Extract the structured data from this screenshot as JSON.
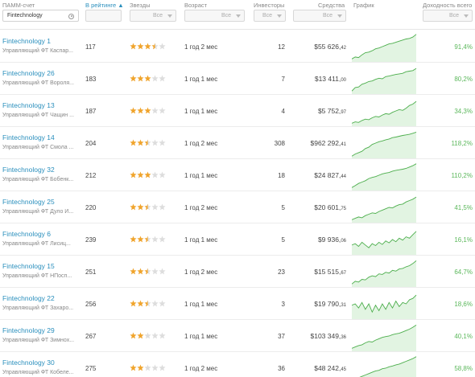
{
  "header": {
    "account_label": "ПАММ-счет",
    "account_filter": "Fintechnology",
    "rating_label": "В рейтинге ▲",
    "rating_filter": "",
    "stars_label": "Звезды",
    "stars_filter": "Все",
    "age_label": "Возраст",
    "age_filter": "Все",
    "investors_label": "Инвесторы",
    "investors_filter": "Все",
    "funds_label": "Средства",
    "funds_filter": "Все",
    "chart_label": "График",
    "yield_label": "Доходность всего",
    "yield_filter": "Все"
  },
  "colors": {
    "link": "#2a8fbd",
    "positive": "#5cb85c",
    "star": "#f0a42c",
    "star_empty": "#dddddd",
    "spark_line": "#4cae4c",
    "spark_fill": "#e2f4e2"
  },
  "rows": [
    {
      "name": "Fintechnology 1",
      "manager": "Управляющий ФТ Каспар...",
      "rank": "117",
      "stars": 3.5,
      "age": "1 год 2 мес",
      "investors": "12",
      "funds": "$55 626,",
      "funds_cents": "42",
      "yield": "91,4%",
      "spark": [
        0.05,
        0.12,
        0.1,
        0.2,
        0.28,
        0.3,
        0.35,
        0.42,
        0.45,
        0.5,
        0.55,
        0.6,
        0.62,
        0.66,
        0.7,
        0.74,
        0.78,
        0.8,
        0.85,
        0.95
      ]
    },
    {
      "name": "Fintechnology 26",
      "manager": "Управляющий ФТ Вороля...",
      "rank": "183",
      "stars": 3,
      "age": "1 год 1 мес",
      "investors": "7",
      "funds": "$13 411,",
      "funds_cents": "00",
      "yield": "80,2%",
      "spark": [
        0.05,
        0.18,
        0.2,
        0.3,
        0.34,
        0.4,
        0.42,
        0.48,
        0.52,
        0.5,
        0.58,
        0.6,
        0.63,
        0.66,
        0.68,
        0.7,
        0.76,
        0.78,
        0.8,
        0.88
      ]
    },
    {
      "name": "Fintechnology 13",
      "manager": "Управляющий ФТ Чащин ...",
      "rank": "187",
      "stars": 3,
      "age": "1 год 1 мес",
      "investors": "4",
      "funds": "$5 752,",
      "funds_cents": "97",
      "yield": "34,3%",
      "spark": [
        0.05,
        0.1,
        0.08,
        0.15,
        0.2,
        0.18,
        0.25,
        0.3,
        0.28,
        0.35,
        0.4,
        0.38,
        0.45,
        0.5,
        0.55,
        0.52,
        0.6,
        0.7,
        0.75,
        0.85
      ]
    },
    {
      "name": "Fintechnology 14",
      "manager": "Управляющий ФТ Смола ...",
      "rank": "204",
      "stars": 2.5,
      "age": "1 год 2 мес",
      "investors": "308",
      "funds": "$962 292,",
      "funds_cents": "41",
      "yield": "118,2%",
      "spark": [
        0.02,
        0.1,
        0.15,
        0.2,
        0.3,
        0.35,
        0.45,
        0.5,
        0.55,
        0.58,
        0.62,
        0.65,
        0.7,
        0.72,
        0.75,
        0.78,
        0.8,
        0.82,
        0.86,
        0.9
      ]
    },
    {
      "name": "Fintechnology 32",
      "manager": "Управляющий ФТ Бобенк...",
      "rank": "212",
      "stars": 3,
      "age": "1 год 1 мес",
      "investors": "18",
      "funds": "$24 827,",
      "funds_cents": "44",
      "yield": "110,2%",
      "spark": [
        0.05,
        0.12,
        0.2,
        0.25,
        0.3,
        0.38,
        0.42,
        0.45,
        0.5,
        0.55,
        0.58,
        0.6,
        0.65,
        0.68,
        0.7,
        0.72,
        0.75,
        0.8,
        0.85,
        0.92
      ]
    },
    {
      "name": "Fintechnology 25",
      "manager": "Управляющий ФТ Дуло И...",
      "rank": "220",
      "stars": 2.5,
      "age": "1 год 2 мес",
      "investors": "5",
      "funds": "$20 601,",
      "funds_cents": "75",
      "yield": "41,5%",
      "spark": [
        0.05,
        0.1,
        0.15,
        0.12,
        0.2,
        0.25,
        0.3,
        0.28,
        0.35,
        0.4,
        0.45,
        0.5,
        0.48,
        0.55,
        0.6,
        0.62,
        0.7,
        0.75,
        0.8,
        0.88
      ]
    },
    {
      "name": "Fintechnology 6",
      "manager": "Управляющий ФТ Лисиц...",
      "rank": "239",
      "stars": 2.5,
      "age": "1 год 1 мес",
      "investors": "5",
      "funds": "$9 936,",
      "funds_cents": "06",
      "yield": "16,1%",
      "spark": [
        0.3,
        0.35,
        0.25,
        0.4,
        0.3,
        0.2,
        0.35,
        0.28,
        0.4,
        0.32,
        0.45,
        0.38,
        0.5,
        0.42,
        0.55,
        0.48,
        0.6,
        0.55,
        0.68,
        0.8
      ]
    },
    {
      "name": "Fintechnology 15",
      "manager": "Управляющий ФТ НПосп...",
      "rank": "251",
      "stars": 2.5,
      "age": "1 год 2 мес",
      "investors": "23",
      "funds": "$15 515,",
      "funds_cents": "67",
      "yield": "64,7%",
      "spark": [
        0.05,
        0.15,
        0.12,
        0.22,
        0.2,
        0.3,
        0.35,
        0.32,
        0.42,
        0.4,
        0.48,
        0.45,
        0.55,
        0.52,
        0.6,
        0.62,
        0.68,
        0.72,
        0.8,
        0.9
      ]
    },
    {
      "name": "Fintechnology 22",
      "manager": "Управляющий ФТ Захаро...",
      "rank": "256",
      "stars": 2.5,
      "age": "1 год 1 мес",
      "investors": "3",
      "funds": "$19 790,",
      "funds_cents": "31",
      "yield": "18,6%",
      "spark": [
        0.45,
        0.5,
        0.35,
        0.55,
        0.3,
        0.5,
        0.2,
        0.45,
        0.25,
        0.5,
        0.3,
        0.55,
        0.35,
        0.6,
        0.4,
        0.55,
        0.5,
        0.65,
        0.7,
        0.82
      ]
    },
    {
      "name": "Fintechnology 29",
      "manager": "Управляющий ФТ Зимнох...",
      "rank": "267",
      "stars": 2,
      "age": "1 год 1 мес",
      "investors": "37",
      "funds": "$103 349,",
      "funds_cents": "36",
      "yield": "40,1%",
      "spark": [
        0.05,
        0.1,
        0.15,
        0.18,
        0.25,
        0.3,
        0.28,
        0.35,
        0.4,
        0.45,
        0.48,
        0.5,
        0.55,
        0.58,
        0.6,
        0.65,
        0.7,
        0.75,
        0.82,
        0.9
      ]
    },
    {
      "name": "Fintechnology 30",
      "manager": "Управляющий ФТ Кобеле...",
      "rank": "275",
      "stars": 2,
      "age": "1 год 2 мес",
      "investors": "36",
      "funds": "$48 242,",
      "funds_cents": "45",
      "yield": "58,8%",
      "spark": [
        0.05,
        0.12,
        0.15,
        0.2,
        0.25,
        0.3,
        0.35,
        0.4,
        0.42,
        0.48,
        0.5,
        0.55,
        0.58,
        0.62,
        0.65,
        0.7,
        0.75,
        0.8,
        0.85,
        0.92
      ]
    }
  ]
}
